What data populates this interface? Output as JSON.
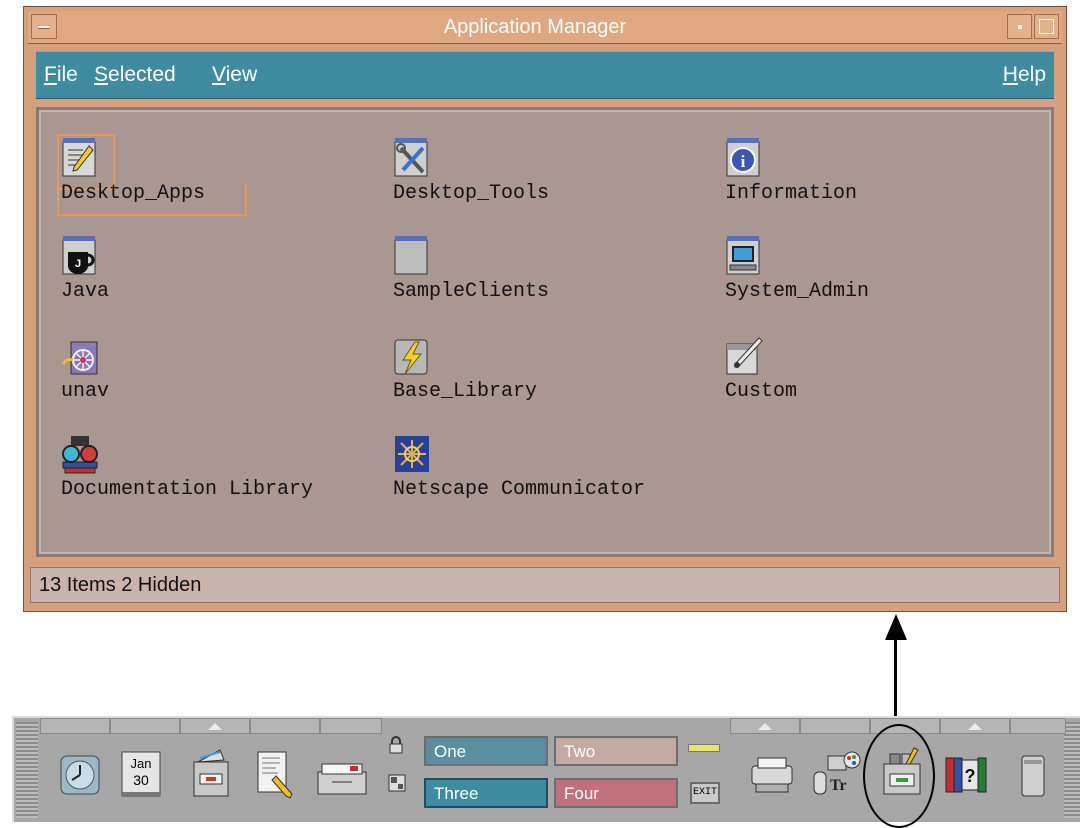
{
  "window": {
    "title": "Application Manager",
    "menu": {
      "file": {
        "mnemonic": "F",
        "rest": "ile"
      },
      "selected": {
        "mnemonic": "S",
        "rest": "elected"
      },
      "view": {
        "mnemonic": "V",
        "rest": "iew"
      },
      "help": {
        "mnemonic": "H",
        "rest": "elp"
      }
    },
    "items": [
      {
        "label": "Desktop_Apps",
        "icon": "notepad-pencil-icon",
        "selected": true
      },
      {
        "label": "Desktop_Tools",
        "icon": "screwdriver-wrench-icon"
      },
      {
        "label": "Information",
        "icon": "info-icon"
      },
      {
        "label": "Java",
        "icon": "java-coffee-icon"
      },
      {
        "label": "SampleClients",
        "icon": "folder-icon"
      },
      {
        "label": "System_Admin",
        "icon": "monitor-icon"
      },
      {
        "label": "unav",
        "icon": "unav-icon"
      },
      {
        "label": "Base_Library",
        "icon": "lightning-icon"
      },
      {
        "label": "Custom",
        "icon": "pencil-canvas-icon"
      },
      {
        "label": "Documentation Library",
        "icon": "binoculars-books-icon"
      },
      {
        "label": "Netscape Communicator",
        "icon": "netscape-icon"
      }
    ],
    "status": "13 Items 2 Hidden"
  },
  "front_panel": {
    "calendar": {
      "month": "Jan",
      "day": "30"
    },
    "workspaces": [
      "One",
      "Two",
      "Three",
      "Four"
    ],
    "exit_label": "EXIT"
  },
  "colors": {
    "window_frame": "#d6a07c",
    "menubar": "#3f8ca1",
    "content_bg": "#a99891",
    "panel_bg": "#a7a7a7"
  }
}
